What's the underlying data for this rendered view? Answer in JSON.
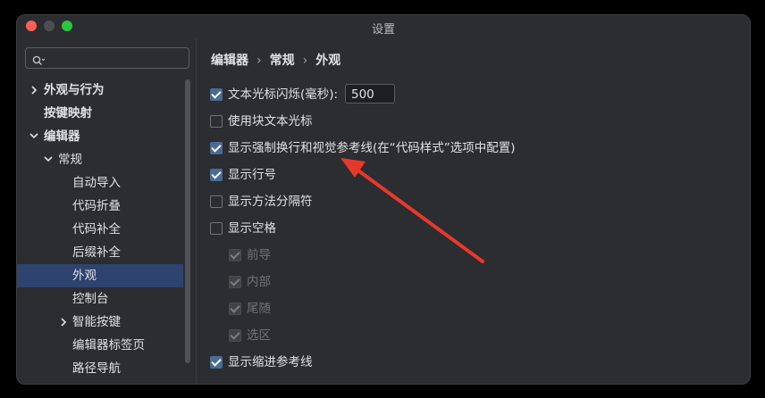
{
  "window": {
    "title": "设置"
  },
  "search": {
    "placeholder": ""
  },
  "sidebar": {
    "items": [
      {
        "label": "外观与行为"
      },
      {
        "label": "按键映射"
      },
      {
        "label": "编辑器"
      },
      {
        "label": "常规"
      },
      {
        "label": "自动导入"
      },
      {
        "label": "代码折叠"
      },
      {
        "label": "代码补全"
      },
      {
        "label": "后缀补全"
      },
      {
        "label": "外观"
      },
      {
        "label": "控制台"
      },
      {
        "label": "智能按键"
      },
      {
        "label": "编辑器标签页"
      },
      {
        "label": "路径导航"
      }
    ]
  },
  "breadcrumb": {
    "items": [
      "编辑器",
      "常规",
      "外观"
    ],
    "separator": "›"
  },
  "options": [
    {
      "label": "文本光标闪烁(毫秒):",
      "checked": true,
      "value": "500"
    },
    {
      "label": "使用块文本光标",
      "checked": false
    },
    {
      "label": "显示强制换行和视觉参考线(在“代码样式”选项中配置)",
      "checked": true
    },
    {
      "label": "显示行号",
      "checked": true
    },
    {
      "label": "显示方法分隔符",
      "checked": false
    },
    {
      "label": "显示空格",
      "checked": false
    },
    {
      "label": "前导",
      "checked": true,
      "disabled": true
    },
    {
      "label": "内部",
      "checked": true,
      "disabled": true
    },
    {
      "label": "尾随",
      "checked": true,
      "disabled": true
    },
    {
      "label": "选区",
      "checked": true,
      "disabled": true
    },
    {
      "label": "显示缩进参考线",
      "checked": true
    }
  ],
  "colors": {
    "selection": "#2e436e",
    "checkbox": "#4a6b93",
    "annotation_arrow": "#e8382c"
  }
}
